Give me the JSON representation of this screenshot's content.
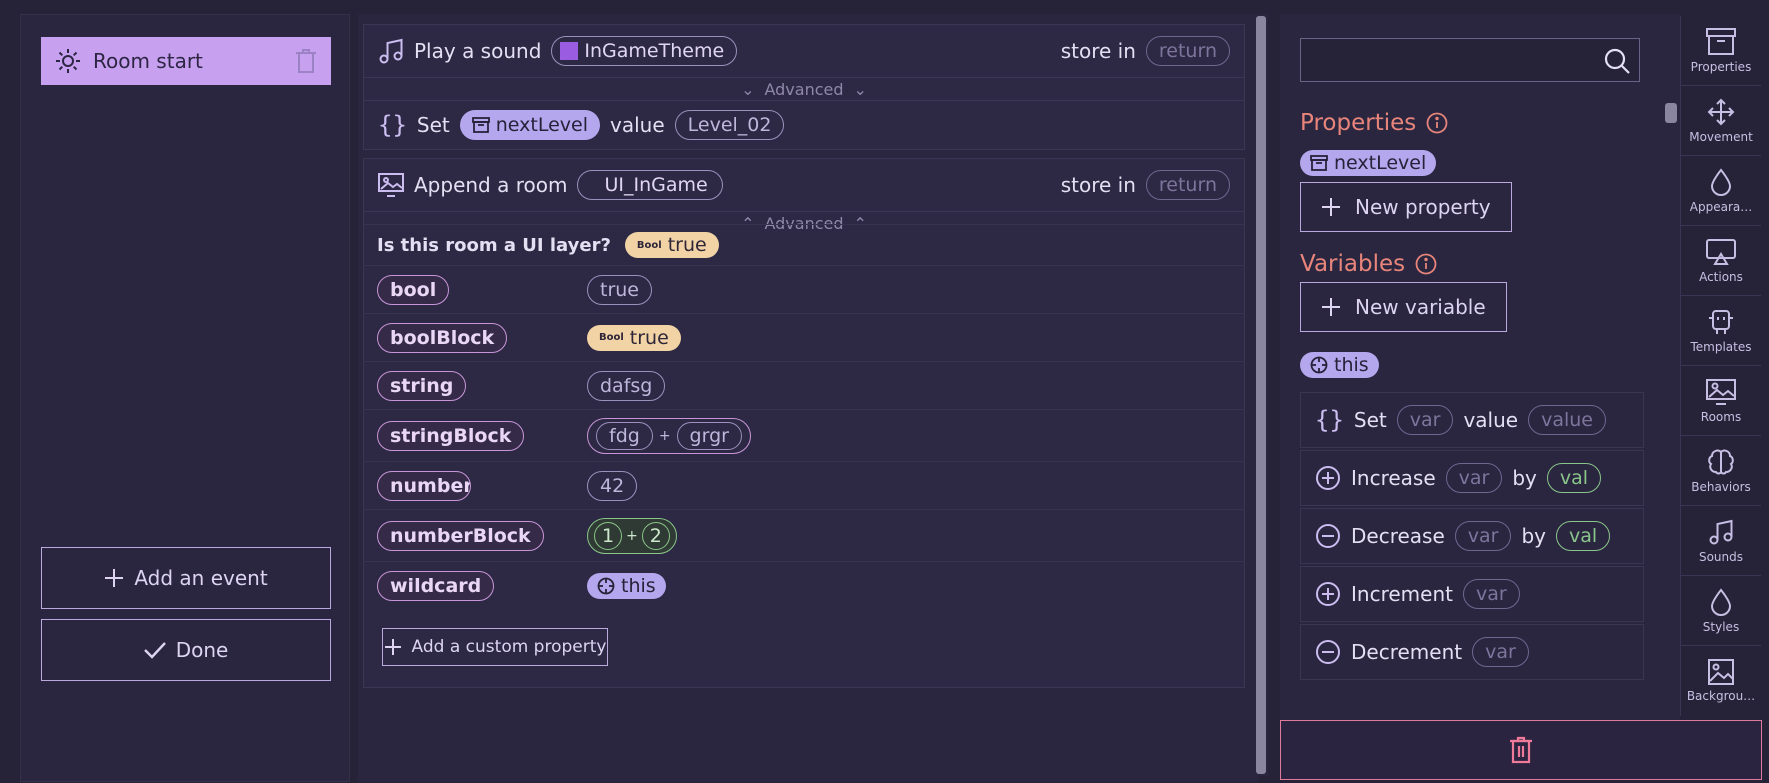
{
  "left": {
    "event_label": "Room start",
    "add_event_label": "Add an event",
    "done_label": "Done"
  },
  "middle": {
    "play_sound": {
      "label": "Play a sound",
      "sound": "InGameTheme",
      "store_in": "store in",
      "return": "return",
      "advanced": "Advanced"
    },
    "set_block": {
      "label": "Set",
      "var": "nextLevel",
      "value_label": "value",
      "value": "Level_02"
    },
    "append_room": {
      "label": "Append a room",
      "room": "UI_InGame",
      "store_in": "store in",
      "return": "return",
      "advanced": "Advanced"
    },
    "ui_layer": {
      "question": "Is this room a UI layer?",
      "bool_icon": "Bool",
      "value": "true"
    },
    "properties": [
      {
        "key": "bool",
        "type": "plain",
        "value": "true"
      },
      {
        "key": "boolBlock",
        "type": "bool",
        "value": "true"
      },
      {
        "key": "string",
        "type": "plain",
        "value": "dafsg"
      },
      {
        "key": "stringBlock",
        "type": "concat",
        "a": "fdg",
        "op": "+",
        "b": "grgr"
      },
      {
        "key": "number",
        "type": "plain",
        "value": "42"
      },
      {
        "key": "numberBlock",
        "type": "math",
        "a": "1",
        "op": "+",
        "b": "2"
      },
      {
        "key": "wildcard",
        "type": "this",
        "value": "this"
      }
    ],
    "add_custom_property": "Add a custom property"
  },
  "right": {
    "search_placeholder": "",
    "properties_title": "Properties",
    "property_chip": "nextLevel",
    "new_property": "New property",
    "variables_title": "Variables",
    "new_variable": "New variable",
    "this_chip": "this",
    "blocks": [
      {
        "verb": "Set",
        "a": "var",
        "mid": "value",
        "b": "value"
      },
      {
        "verb": "Increase",
        "a": "var",
        "mid": "by",
        "b": "val"
      },
      {
        "verb": "Decrease",
        "a": "var",
        "mid": "by",
        "b": "val"
      },
      {
        "verb": "Increment",
        "a": "var"
      },
      {
        "verb": "Decrement",
        "a": "var"
      }
    ]
  },
  "tabs": [
    "Properties",
    "Movement",
    "Appeara…",
    "Actions",
    "Templates",
    "Rooms",
    "Behaviors",
    "Sounds",
    "Styles",
    "Backgrou…"
  ],
  "colors": {
    "accent_pink": "#e8857a",
    "event_bg": "#c8a0f0",
    "lavender": "#b4a7ee",
    "bool_bg": "#f2d3a6",
    "green": "#8ac58a",
    "delete": "#e07a9a"
  }
}
